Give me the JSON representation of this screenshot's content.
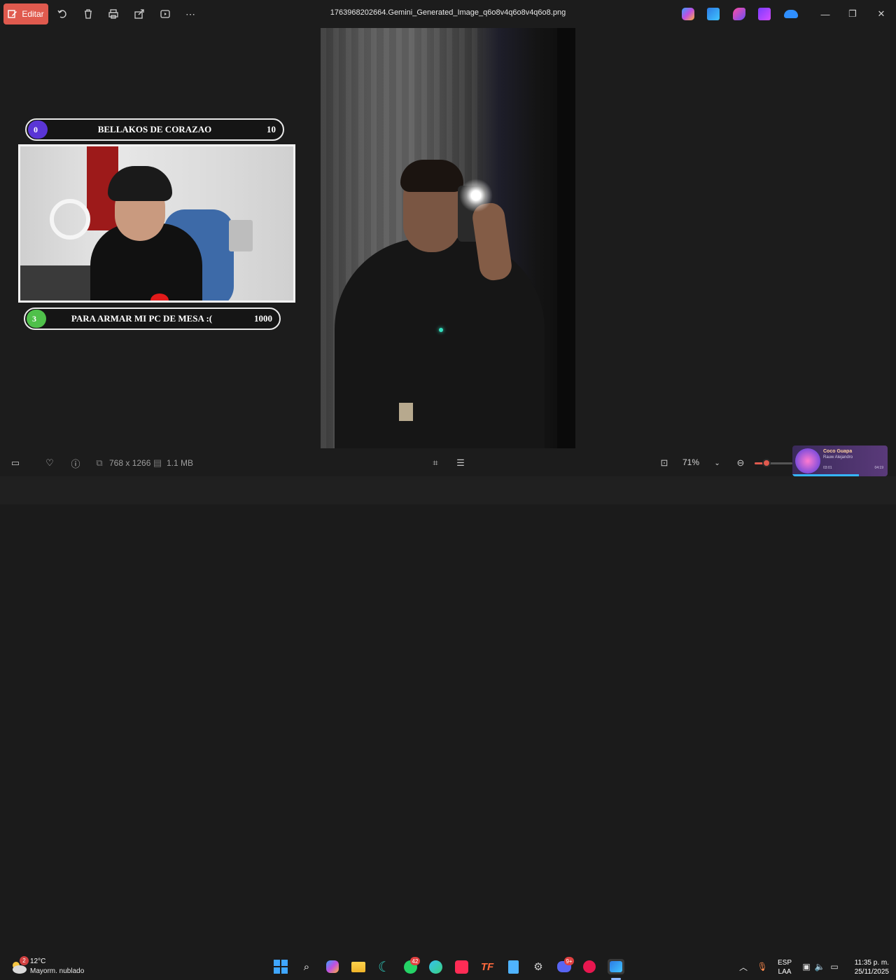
{
  "toolbar": {
    "edit_label": "Editar",
    "filename": "1763968202664.Gemini_Generated_Image_q6o8v4q6o8v4q6o8.png",
    "icons": [
      "rotate-icon",
      "delete-icon",
      "print-icon",
      "share-icon",
      "slideshow-icon",
      "more-icon"
    ]
  },
  "overlay": {
    "goal1": {
      "count": "0",
      "title": "BELLAKOS DE CORAZAO",
      "target": "10",
      "color": "#5a35d6"
    },
    "goal2": {
      "count": "3",
      "title": "PARA ARMAR MI PC DE MESA :(",
      "target": "1000",
      "color": "#4fc04a"
    }
  },
  "status": {
    "dimensions": "768 x 1266",
    "filesize": "1.1 MB",
    "zoom": "71%",
    "zoom_level": 0.3
  },
  "media": {
    "title": "Coco Guapa",
    "artist": "Rauw Alejandro",
    "elapsed": "03:01",
    "duration": "04:19",
    "progress": 0.7
  },
  "taskbar": {
    "weather_badge": "2",
    "temperature": "12°C",
    "condition": "Mayorm. nublado",
    "whatsapp_badge": "42",
    "discord_badge": "9+",
    "lang_top": "ESP",
    "lang_bottom": "LAA",
    "time": "11:35 p. m.",
    "date": "25/11/2025"
  },
  "colors": {
    "accent": "#e05a4e",
    "background": "#1c1c1c"
  }
}
